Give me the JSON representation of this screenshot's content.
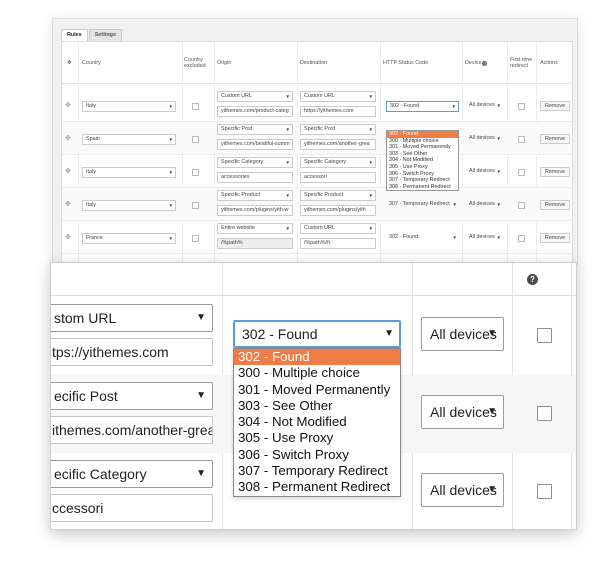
{
  "tabs": [
    {
      "label": "Rules",
      "active": true
    },
    {
      "label": "Settings",
      "active": false
    }
  ],
  "columns": {
    "country": "Country",
    "country_excluded": "Country excluded",
    "origin": "Origin",
    "destination": "Destination",
    "status": "HTTP Status Code",
    "device": "Device",
    "first_time": "First time redirect",
    "actions": "Actions"
  },
  "rows": [
    {
      "country": "Italy",
      "origin_type": "Custom URL",
      "origin_value": "yithemes.com/product-categ",
      "dest_type": "Custom URL",
      "dest_value": "https://yithemes.com",
      "status": "302 - Found",
      "device": "All devices",
      "action": "Remove"
    },
    {
      "country": "Spain",
      "origin_type": "Specific Post",
      "origin_value": "yithemes.com/beatiful-summ",
      "dest_type": "Specific Post",
      "dest_value": "yithemes.com/another-grea",
      "status": "",
      "device": "All devices",
      "action": "Remove"
    },
    {
      "country": "Italy",
      "origin_type": "Specific Category",
      "origin_value": "accessories",
      "dest_type": "Specific Category",
      "dest_value": "accessori",
      "status": "",
      "device": "All devices",
      "action": "Remove"
    },
    {
      "country": "Italy",
      "origin_type": "Specific Product",
      "origin_value": "yithemes.com/plugins/yith-w",
      "dest_type": "Specific Product",
      "dest_value": "yithemes.com/plugins/yith",
      "status": "307 - Temporary Redirect",
      "device": "All devices",
      "action": "Remove"
    },
    {
      "country": "France",
      "origin_type": "Entire website",
      "origin_value": "/%path%",
      "dest_type": "Custom URL",
      "dest_value": "/%path%/fr",
      "status": "302 - Found",
      "device": "All devices",
      "action": "Remove"
    }
  ],
  "status_options": [
    "302 - Found",
    "300 - Multiple choice",
    "301 - Moved Permanently",
    "303 - See Other",
    "304 - Not Modified",
    "305 - Use Proxy",
    "306 - Switch Proxy",
    "307 - Temporary Redirect",
    "308 - Permanent Redirect"
  ],
  "zoom": {
    "rows": [
      {
        "dest_type": "stom URL",
        "dest_value": "tps://yithemes.com",
        "status": "302 - Found",
        "device": "All devices"
      },
      {
        "dest_type": "ecific Post",
        "dest_value": "ithemes.com/another-grea",
        "device": "All devices"
      },
      {
        "dest_type": "ecific Category",
        "dest_value": "ccessori",
        "device": "All devices"
      }
    ]
  },
  "icons": {
    "drag": "move-icon",
    "help": "help-icon",
    "dropdown": "chevron-down-icon"
  },
  "colors": {
    "highlight": "#f07c46",
    "focus": "#5b9dd9"
  }
}
